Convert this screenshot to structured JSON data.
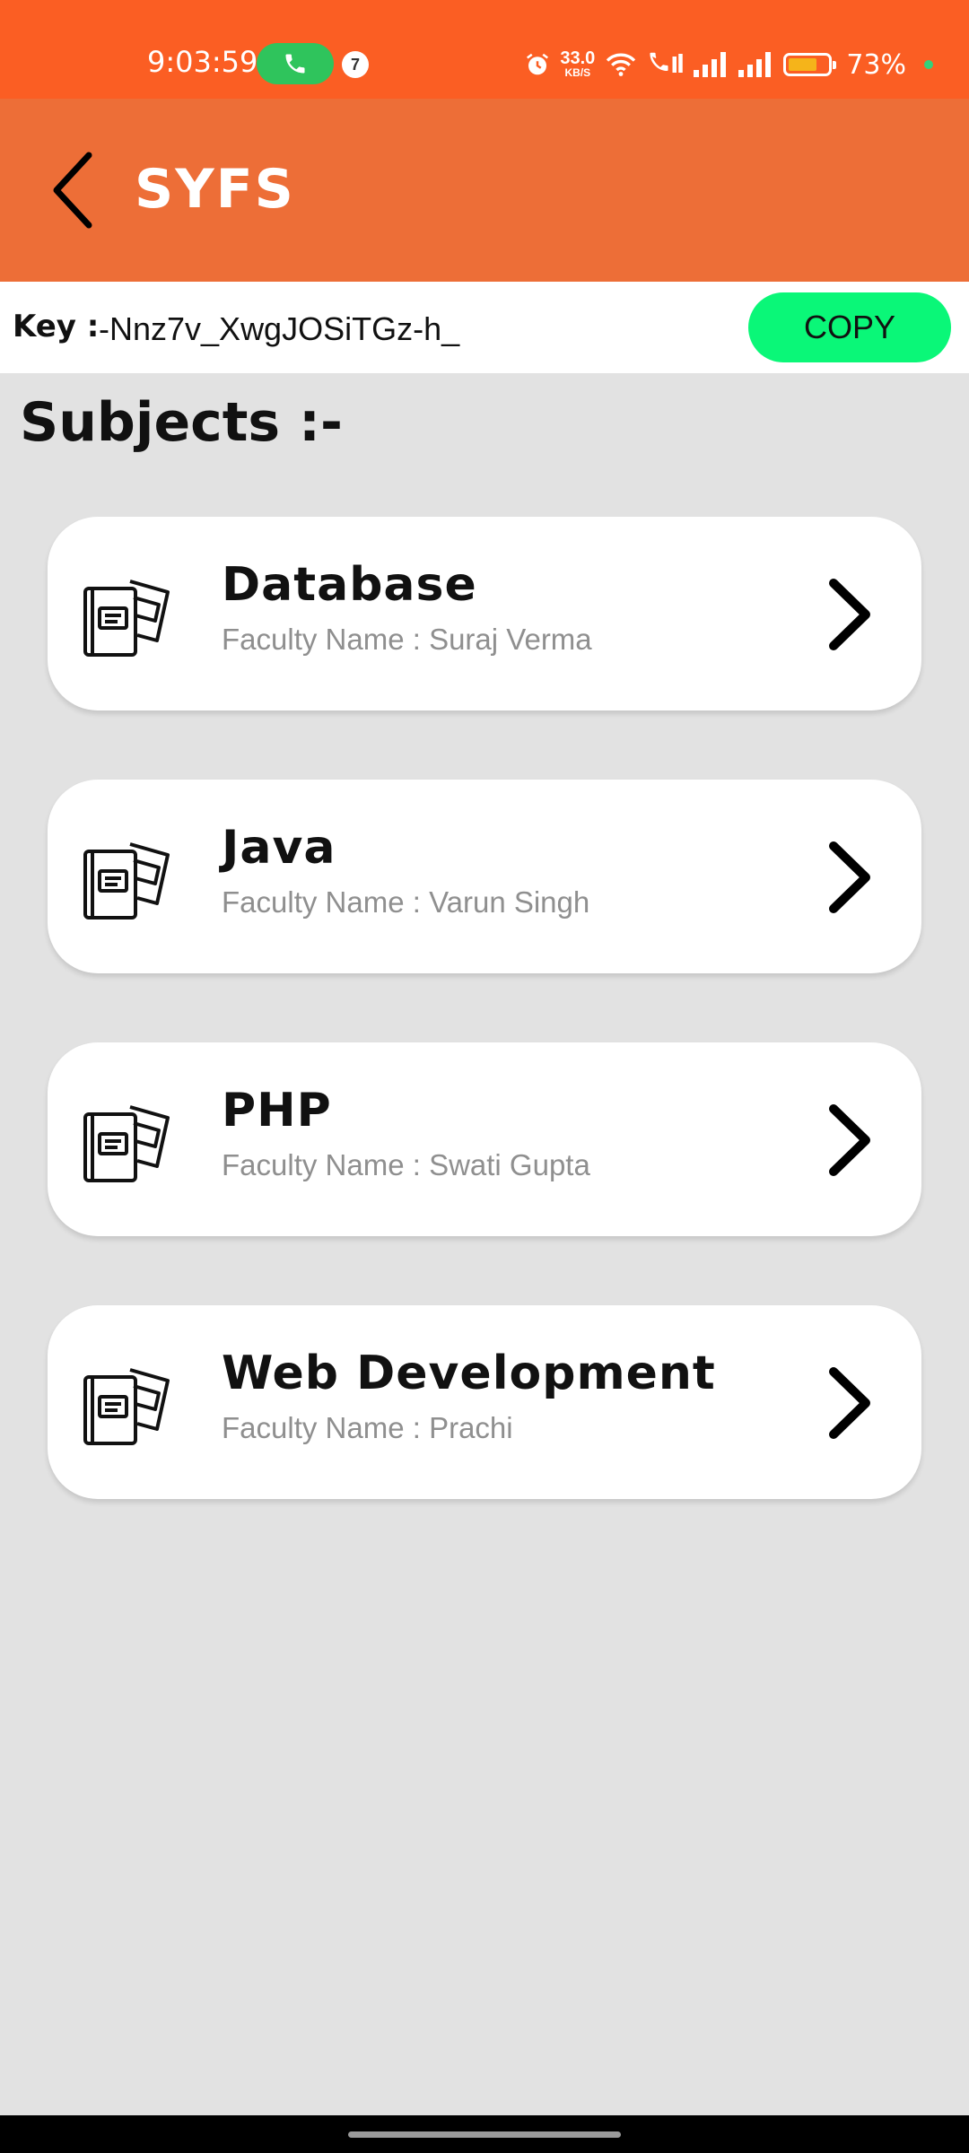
{
  "status_bar": {
    "time": "9:03:59",
    "notification_count": "7",
    "net_speed_value": "33.0",
    "net_speed_unit": "KB/S",
    "battery_percent": "73%",
    "battery_level": 0.73,
    "colors": {
      "background": "#fb5e23",
      "call_pill": "#2fc45c",
      "battery_fill": "#f5b41a"
    },
    "icons": [
      "phone-icon",
      "alarm-icon",
      "wifi-icon",
      "wifi-calling-icon",
      "signal-icon",
      "battery-icon"
    ]
  },
  "app_bar": {
    "title": "SYFS",
    "back_icon": "back-arrow-icon",
    "color": "#ed6e37"
  },
  "key_row": {
    "label": "Key :",
    "value": "-Nnz7v_XwgJOSiTGz-h_",
    "copy_label": "COPY",
    "copy_color": "#0af778"
  },
  "subjects": {
    "heading": "Subjects :-",
    "items": [
      {
        "name": "Database",
        "faculty": "Faculty Name : Suraj Verma",
        "icon": "books-icon"
      },
      {
        "name": "Java",
        "faculty": "Faculty Name : Varun Singh",
        "icon": "books-icon"
      },
      {
        "name": "PHP",
        "faculty": "Faculty Name : Swati Gupta",
        "icon": "books-icon"
      },
      {
        "name": "Web Development",
        "faculty": "Faculty Name : Prachi",
        "icon": "books-icon"
      }
    ]
  }
}
